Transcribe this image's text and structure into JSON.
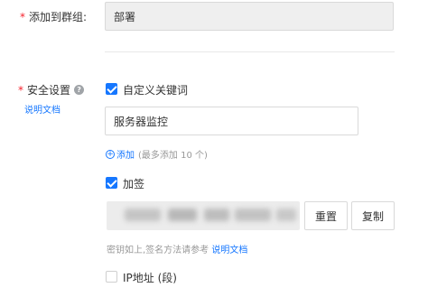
{
  "group": {
    "required_mark": "*",
    "label": "添加到群组:",
    "value": "部署"
  },
  "security": {
    "required_mark": "*",
    "label": "安全设置",
    "help_icon": "question-circle-icon",
    "doc_link": "说明文档",
    "keyword": {
      "checked": true,
      "label": "自定义关键词",
      "value": "服务器监控",
      "add_label": "添加",
      "add_hint": "(最多添加 10 个)"
    },
    "sign": {
      "checked": true,
      "label": "加签",
      "reset_label": "重置",
      "copy_label": "复制",
      "hint_prefix": "密钥如上,签名方法请参考",
      "hint_link": "说明文档"
    },
    "ip": {
      "checked": false,
      "label": "IP地址 (段)"
    }
  },
  "colors": {
    "accent": "#1677ff",
    "required": "#f5222d"
  }
}
